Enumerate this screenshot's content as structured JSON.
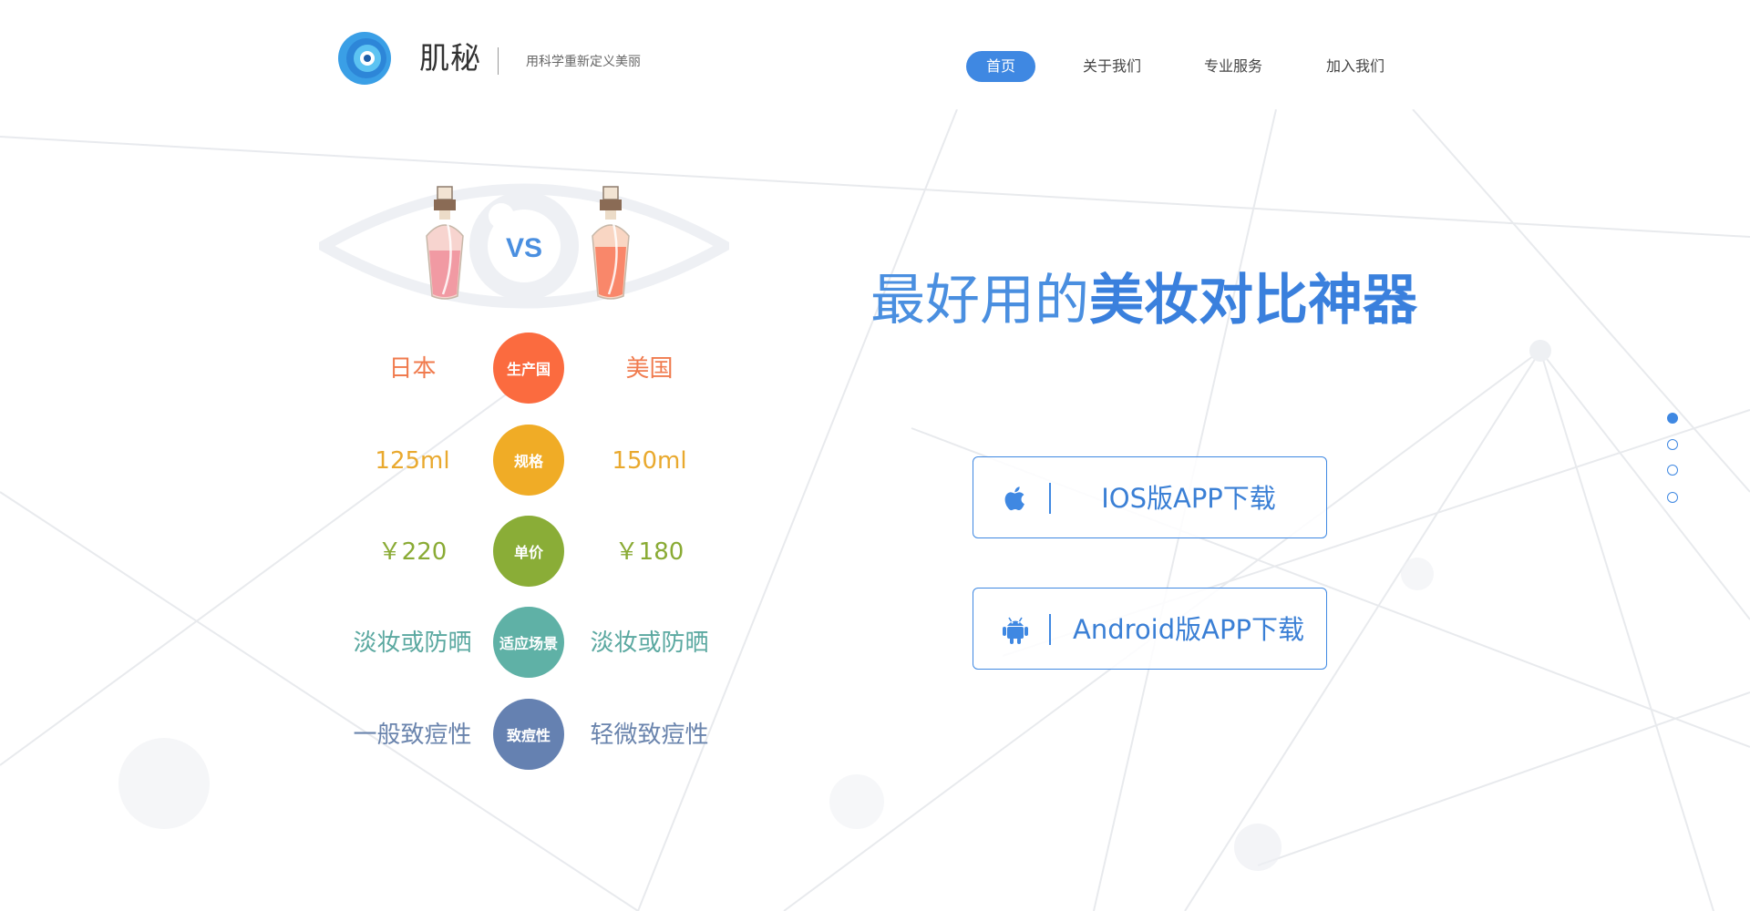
{
  "header": {
    "brand_name": "肌秘",
    "slogan": "用科学重新定义美丽",
    "nav": [
      {
        "label": "首页",
        "active": true
      },
      {
        "label": "关于我们",
        "active": false
      },
      {
        "label": "专业服务",
        "active": false
      },
      {
        "label": "加入我们",
        "active": false
      }
    ]
  },
  "comparison": {
    "vs_label": "VS",
    "rows": [
      {
        "label": "生产国",
        "left": "日本",
        "right": "美国",
        "color": "#fb6b3f",
        "text_color": "#f07b4e"
      },
      {
        "label": "规格",
        "left": "125ml",
        "right": "150ml",
        "color": "#f0ac26",
        "text_color": "#e9a92e"
      },
      {
        "label": "单价",
        "left": "￥220",
        "right": "￥180",
        "color": "#8aad37",
        "text_color": "#8aab35"
      },
      {
        "label": "适应场景",
        "left": "淡妆或防晒",
        "right": "淡妆或防晒",
        "color": "#5fb1a6",
        "text_color": "#5aa8a0"
      },
      {
        "label": "致痘性",
        "left": "一般致痘性",
        "right": "轻微致痘性",
        "color": "#6581b1",
        "text_color": "#6a84ad"
      }
    ]
  },
  "hero": {
    "headline_light": "最好用的",
    "headline_bold": "美妆对比神器",
    "ios_button": "IOS版APP下载",
    "android_button": "Android版APP下载"
  },
  "icons": {
    "logo": "eye-logo-icon",
    "ios": "apple-icon",
    "android": "android-icon"
  },
  "pagination": {
    "count": 4,
    "active_index": 0
  },
  "colors": {
    "accent": "#3f88e2"
  }
}
